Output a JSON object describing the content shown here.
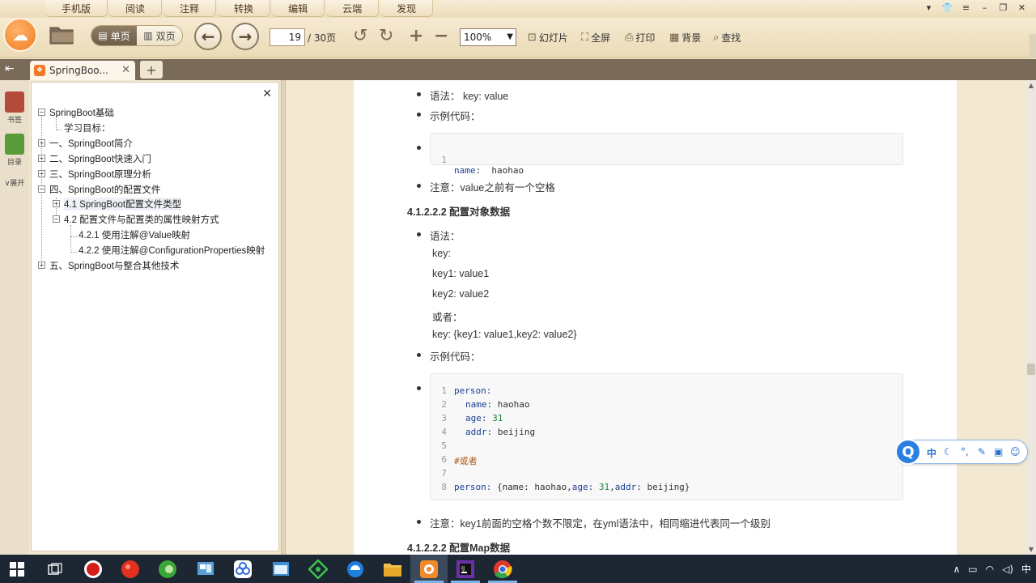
{
  "menu_tabs": [
    "手机版",
    "阅读",
    "注释",
    "转换",
    "编辑",
    "云端",
    "发现"
  ],
  "toolbar": {
    "single_page": "单页",
    "double_page": "双页",
    "current_page": "19",
    "page_total": "/ 30页",
    "zoom": "100%",
    "slideshow": "幻灯片",
    "fullscreen": "全屏",
    "print": "打印",
    "background": "背景",
    "search": "查找"
  },
  "tab": {
    "title": "SpringBoo..."
  },
  "left_rail": {
    "bookmarks": "书签",
    "toc": "目录",
    "expand": "展开"
  },
  "toc": {
    "items": [
      "SpringBoot基础",
      "学习目标：",
      "一、SpringBoot简介",
      "二、SpringBoot快速入门",
      "三、SpringBoot原理分析",
      "四、SpringBoot的配置文件",
      "4.1 SpringBoot配置文件类型",
      "4.2 配置文件与配置类的属性映射方式",
      "4.2.1 使用注解@Value映射",
      "4.2.2 使用注解@ConfigurationProperties映射",
      "五、SpringBoot与整合其他技术"
    ]
  },
  "doc": {
    "syntax_label": "语法： key: value",
    "example_label": "示例代码：",
    "code1": [
      {
        "ln": "1",
        "key": "name",
        "val": " haohao"
      }
    ],
    "note1": "注意：value之前有一个空格",
    "heading_object": "4.1.2.2.2 配置对象数据",
    "syntax_label2": "语法：",
    "syntax_lines": [
      "key:",
      "key1: value1",
      "key2: value2",
      "或者：",
      "key: {key1: value1,key2: value2}"
    ],
    "example_label2": "示例代码：",
    "code2_lines": [
      "1",
      "2",
      "3",
      "4",
      "5",
      "6",
      "7",
      "8"
    ],
    "code2_person": "person:",
    "code2_name_key": "name:",
    "code2_name_val": " haohao",
    "code2_age_key": "age:",
    "code2_age_val": "31",
    "code2_addr_key": "addr:",
    "code2_addr_val": " beijing",
    "code2_comment": "#或者",
    "code2_line8_a": "person:",
    "code2_line8_b": " {name: haohao,",
    "code2_line8_c": "age:",
    "code2_line8_d": "31",
    "code2_line8_e": ",",
    "code2_line8_f": "addr:",
    "code2_line8_g": " beijing}",
    "note2": "注意：key1前面的空格个数不限定，在yml语法中，相同缩进代表同一个级别",
    "heading_map": "4.1.2.2.2 配置Map数据"
  },
  "ime": {
    "lang": "中"
  },
  "tray": {
    "lang": "中"
  }
}
